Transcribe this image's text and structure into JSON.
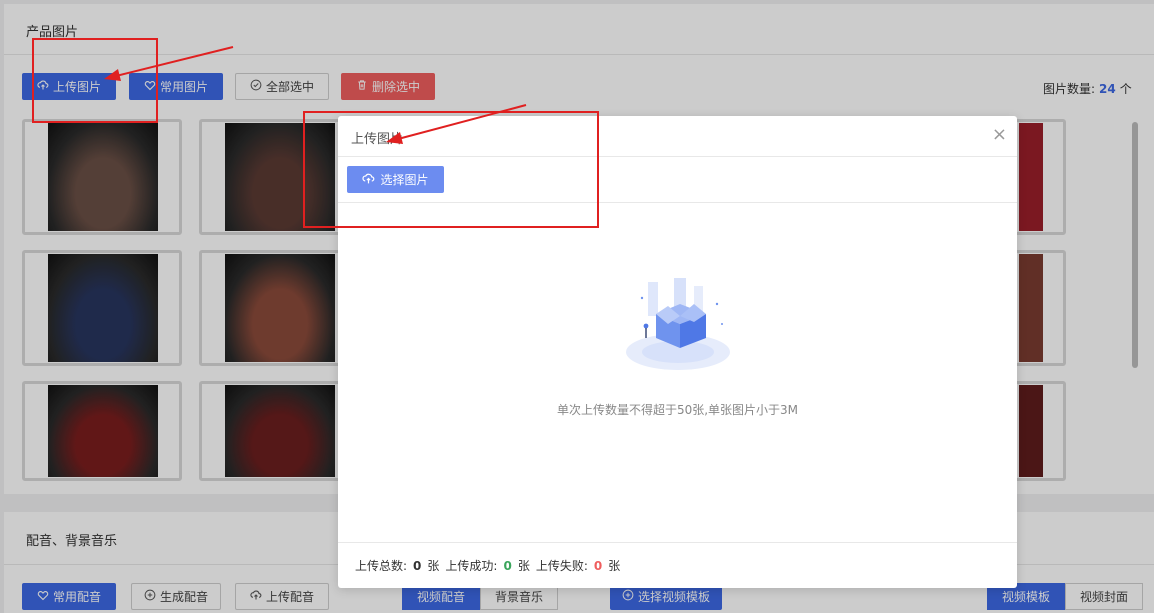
{
  "product_panel": {
    "title": "产品图片",
    "upload_label": "上传图片",
    "favorites_label": "常用图片",
    "select_all_label": "全部选中",
    "delete_label": "删除选中",
    "count_label": "图片数量:",
    "count_value": "24",
    "count_unit": "个"
  },
  "thumbnails": [
    {
      "tone": "#6a4f45"
    },
    {
      "tone": "#5a3a33"
    },
    {
      "tone": "#27355e"
    },
    {
      "tone": "#8a4a3a"
    },
    {
      "tone": "#7a1d1d"
    },
    {
      "tone": "#6b1e1e"
    }
  ],
  "audio_panel": {
    "title": "配音、背景音乐",
    "favorites_voice_label": "常用配音",
    "generate_voice_label": "生成配音",
    "upload_voice_label": "上传配音",
    "tab_voice": "视频配音",
    "tab_bgm": "背景音乐",
    "select_template_label": "选择视频模板",
    "tab_template": "视频模板",
    "tab_cover": "视频封面"
  },
  "modal": {
    "title": "上传图片",
    "close": "×",
    "select_label": "选择图片",
    "hint": "单次上传数量不得超于50张,单张图片小于3M",
    "footer": {
      "total_label": "上传总数:",
      "total_value": "0",
      "success_label": "上传成功:",
      "success_value": "0",
      "fail_label": "上传失败:",
      "fail_value": "0",
      "unit": "张"
    }
  },
  "colors": {
    "primary": "#3c68e4",
    "danger": "#ef5e5e",
    "annotation": "#e02020"
  }
}
